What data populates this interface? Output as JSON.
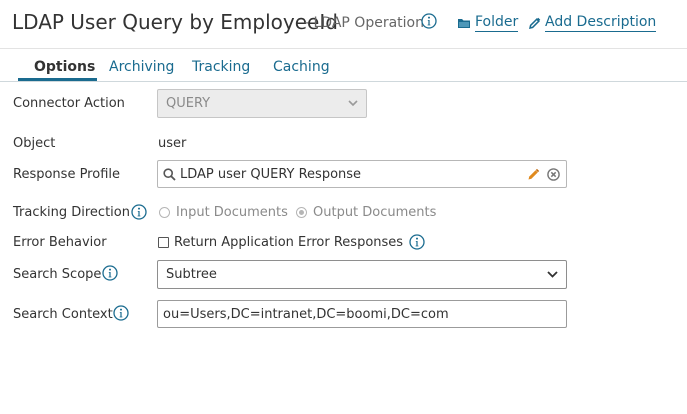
{
  "header": {
    "title": "LDAP User Query by EmployeeId",
    "subtitle": "- LDAP Operation",
    "folder_label": "Folder",
    "add_description_label": "Add Description"
  },
  "tabs": [
    {
      "label": "Options",
      "active": true
    },
    {
      "label": "Archiving",
      "active": false
    },
    {
      "label": "Tracking",
      "active": false
    },
    {
      "label": "Caching",
      "active": false
    }
  ],
  "form": {
    "connector_action": {
      "label": "Connector Action",
      "value": "QUERY",
      "disabled": true
    },
    "object": {
      "label": "Object",
      "value": "user"
    },
    "response_profile": {
      "label": "Response Profile",
      "value": "LDAP user QUERY Response"
    },
    "tracking_direction": {
      "label": "Tracking Direction",
      "options": [
        {
          "label": "Input Documents",
          "checked": false
        },
        {
          "label": "Output Documents",
          "checked": true
        }
      ]
    },
    "error_behavior": {
      "label": "Error Behavior",
      "checkbox_label": "Return Application Error Responses",
      "checked": false
    },
    "search_scope": {
      "label": "Search Scope",
      "value": "Subtree"
    },
    "search_context": {
      "label": "Search Context",
      "value": "ou=Users,DC=intranet,DC=boomi,DC=com"
    }
  },
  "colors": {
    "link": "#1a6b8f",
    "info_icon": "#1a6b8f",
    "pencil": "#e08a1e"
  }
}
